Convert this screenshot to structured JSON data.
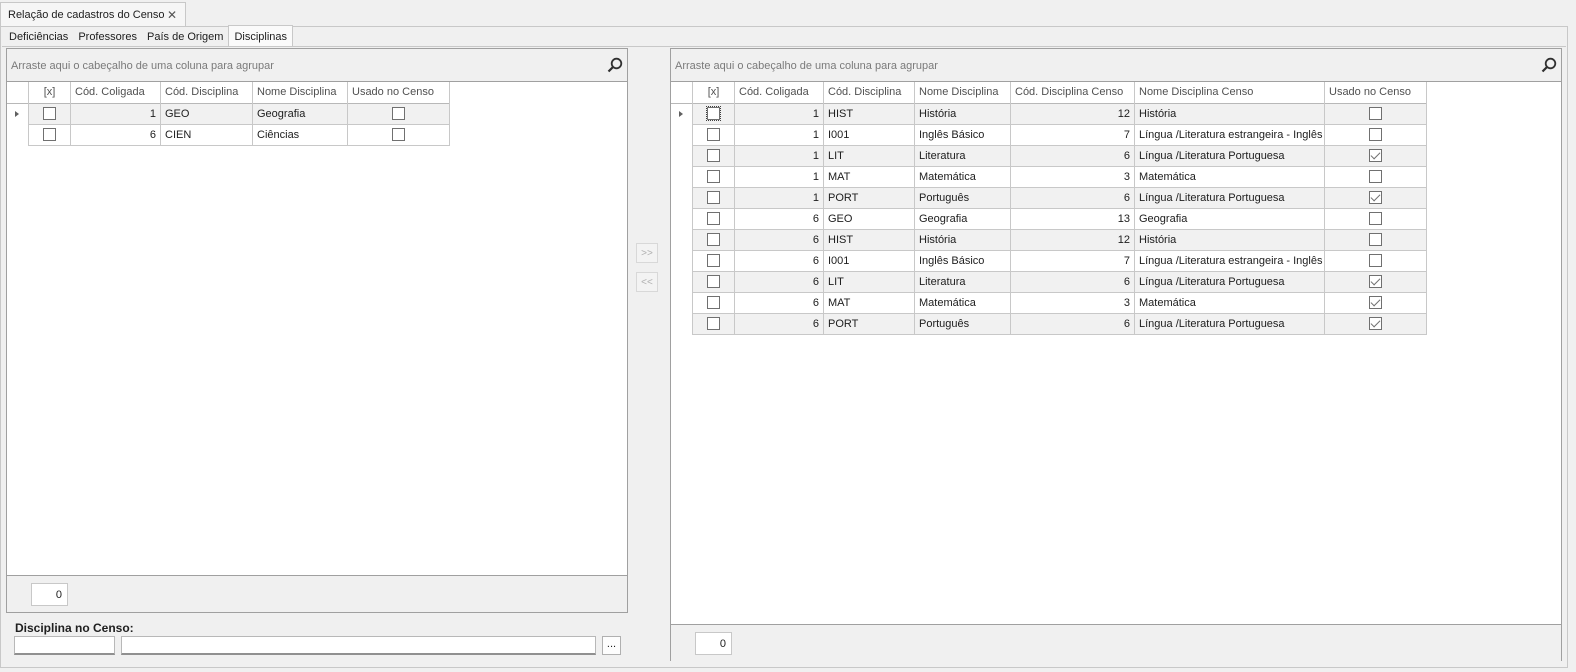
{
  "window": {
    "tab_title": "Relação de cadastros do Censo",
    "close_glyph": "✕"
  },
  "tabs": [
    "Deficiências",
    "Professores",
    "País de Origem",
    "Disciplinas"
  ],
  "active_tab": "Disciplinas",
  "left_grid": {
    "group_hint": "Arraste aqui o cabeçalho de uma coluna para agrupar",
    "columns": [
      "[x]",
      "Cód. Coligada",
      "Cód. Disciplina",
      "Nome Disciplina",
      "Usado no Censo"
    ],
    "rows": [
      {
        "selected": false,
        "coligada": "1",
        "cod": "GEO",
        "nome": "Geografia",
        "usado": false
      },
      {
        "selected": false,
        "coligada": "6",
        "cod": "CIEN",
        "nome": "Ciências",
        "usado": false
      }
    ],
    "count": "0"
  },
  "right_grid": {
    "group_hint": "Arraste aqui o cabeçalho de uma coluna para agrupar",
    "columns": [
      "[x]",
      "Cód. Coligada",
      "Cód. Disciplina",
      "Nome Disciplina",
      "Cód. Disciplina Censo",
      "Nome Disciplina Censo",
      "Usado no Censo"
    ],
    "rows": [
      {
        "selected": false,
        "coligada": "1",
        "cod": "HIST",
        "nome": "História",
        "cod_censo": "12",
        "nome_censo": "História",
        "usado": false
      },
      {
        "selected": false,
        "coligada": "1",
        "cod": "I001",
        "nome": "Inglês Básico",
        "cod_censo": "7",
        "nome_censo": "Língua /Literatura estrangeira - Inglês",
        "usado": false
      },
      {
        "selected": false,
        "coligada": "1",
        "cod": "LIT",
        "nome": "Literatura",
        "cod_censo": "6",
        "nome_censo": "Língua /Literatura Portuguesa",
        "usado": true
      },
      {
        "selected": false,
        "coligada": "1",
        "cod": "MAT",
        "nome": "Matemática",
        "cod_censo": "3",
        "nome_censo": "Matemática",
        "usado": false
      },
      {
        "selected": false,
        "coligada": "1",
        "cod": "PORT",
        "nome": "Português",
        "cod_censo": "6",
        "nome_censo": "Língua /Literatura Portuguesa",
        "usado": true
      },
      {
        "selected": false,
        "coligada": "6",
        "cod": "GEO",
        "nome": "Geografia",
        "cod_censo": "13",
        "nome_censo": "Geografia",
        "usado": false
      },
      {
        "selected": false,
        "coligada": "6",
        "cod": "HIST",
        "nome": "História",
        "cod_censo": "12",
        "nome_censo": "História",
        "usado": false
      },
      {
        "selected": false,
        "coligada": "6",
        "cod": "I001",
        "nome": "Inglês Básico",
        "cod_censo": "7",
        "nome_censo": "Língua /Literatura estrangeira - Inglês",
        "usado": false
      },
      {
        "selected": false,
        "coligada": "6",
        "cod": "LIT",
        "nome": "Literatura",
        "cod_censo": "6",
        "nome_censo": "Língua /Literatura Portuguesa",
        "usado": true
      },
      {
        "selected": false,
        "coligada": "6",
        "cod": "MAT",
        "nome": "Matemática",
        "cod_censo": "3",
        "nome_censo": "Matemática",
        "usado": true
      },
      {
        "selected": false,
        "coligada": "6",
        "cod": "PORT",
        "nome": "Português",
        "cod_censo": "6",
        "nome_censo": "Língua /Literatura Portuguesa",
        "usado": true
      }
    ],
    "count": "0"
  },
  "move_buttons": {
    "add": ">>",
    "remove": "<<"
  },
  "censo_lookup": {
    "label": "Disciplina no Censo:",
    "code": "",
    "name": "",
    "browse": "..."
  },
  "icons": {
    "search": "search-icon",
    "row_indicator": "caret-right-icon"
  }
}
